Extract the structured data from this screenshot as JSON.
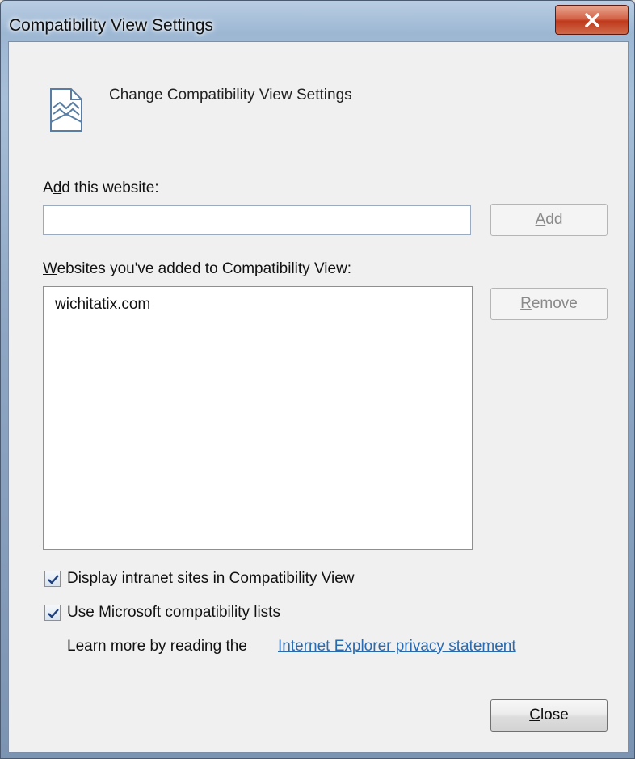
{
  "window": {
    "title": "Compatibility View Settings"
  },
  "header": {
    "title": "Change Compatibility View Settings"
  },
  "add_site": {
    "label_pre": "A",
    "label_accel": "d",
    "label_post": "d this website:",
    "value": "",
    "button_accel": "A",
    "button_rest": "dd"
  },
  "sites": {
    "label_accel": "W",
    "label_rest": "ebsites you've added to Compatibility View:",
    "items": [
      "wichitatix.com"
    ],
    "remove_accel": "R",
    "remove_rest": "emove"
  },
  "options": {
    "intranet": {
      "checked": true,
      "pre": "Display ",
      "accel": "i",
      "post": "ntranet sites in Compatibility View"
    },
    "ms_lists": {
      "checked": true,
      "pre": "",
      "accel": "U",
      "post": "se Microsoft compatibility lists"
    }
  },
  "learn_more": {
    "text": "Learn more by reading the",
    "link": "Internet Explorer privacy statement"
  },
  "footer": {
    "close_accel": "C",
    "close_rest": "lose"
  },
  "colors": {
    "link": "#2a6bb0",
    "close_button": "#c0391c"
  }
}
